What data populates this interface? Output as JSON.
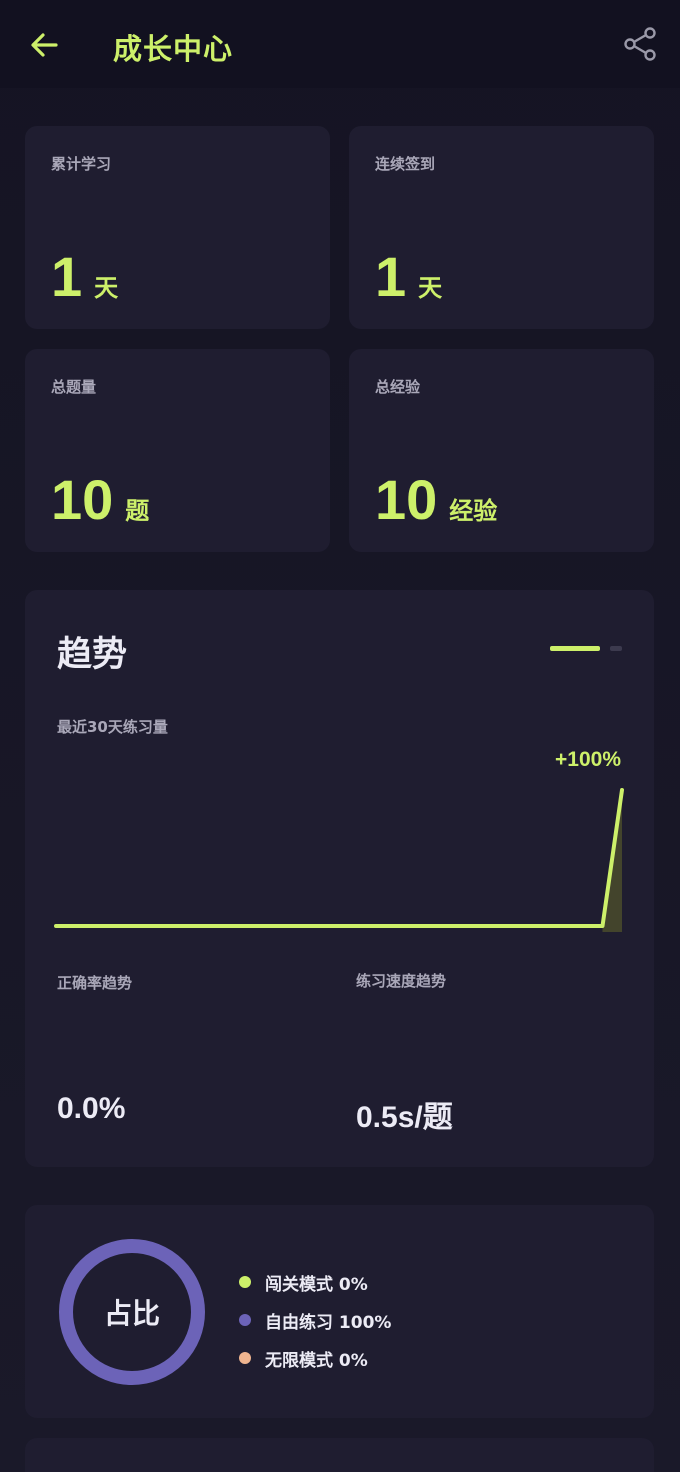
{
  "header": {
    "title": "成长中心"
  },
  "icons": {
    "back": "arrow-left-icon",
    "share": "share-icon"
  },
  "stats": [
    {
      "label": "累计学习",
      "value": "1",
      "unit": "天"
    },
    {
      "label": "连续签到",
      "value": "1",
      "unit": "天"
    },
    {
      "label": "总题量",
      "value": "10",
      "unit": "题"
    },
    {
      "label": "总经验",
      "value": "10",
      "unit": "经验"
    }
  ],
  "trend": {
    "title": "趋势",
    "subtitle": "最近30天练习量",
    "change": "+100%",
    "accuracy_label": "正确率趋势",
    "accuracy_value": "0.0%",
    "speed_label": "练习速度趋势",
    "speed_value": "0.5s/题"
  },
  "chart_data": {
    "type": "line",
    "series": [
      {
        "values": [
          0,
          0,
          0,
          0,
          0,
          0,
          0,
          0,
          0,
          0,
          0,
          0,
          0,
          0,
          0,
          0,
          0,
          0,
          0,
          0,
          0,
          0,
          0,
          0,
          0,
          0,
          0,
          0,
          0,
          10
        ]
      }
    ],
    "annotation": "+100%"
  },
  "share": {
    "center_label": "占比",
    "items": [
      {
        "label": "闯关模式 0%",
        "color": "#cdf06a",
        "percent": 0
      },
      {
        "label": "自由练习 100%",
        "color": "#6c63b8",
        "percent": 100
      },
      {
        "label": "无限模式 0%",
        "color": "#efb48f",
        "percent": 0
      }
    ]
  },
  "colors": {
    "accent": "#cdf06a",
    "background": "#17162a",
    "card": "#1f1d30"
  }
}
